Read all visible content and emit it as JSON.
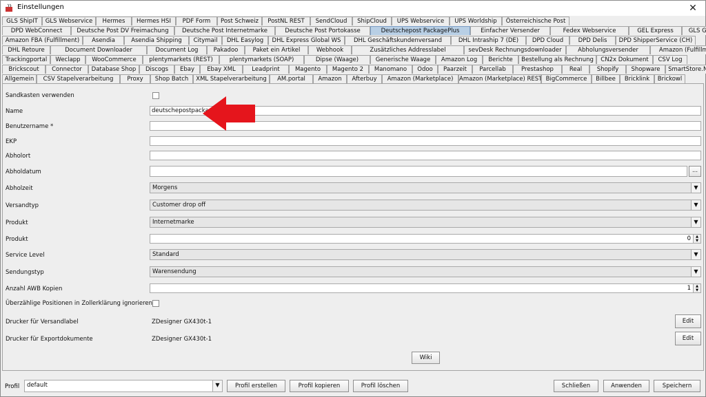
{
  "window": {
    "title": "Einstellungen",
    "close_glyph": "✕"
  },
  "tabs": {
    "row1": [
      "GLS ShipIT",
      "GLS Webservice",
      "Hermes",
      "Hermes HSI",
      "PDF Form",
      "Post Schweiz",
      "PostNL REST",
      "SendCloud",
      "ShipCloud",
      "UPS Webservice",
      "UPS Worldship",
      "Österreichische Post"
    ],
    "row2": [
      "DPD WebConnect",
      "Deutsche Post DV Freimachung",
      "Deutsche Post Internetmarke",
      "Deutsche Post Portokasse",
      "Deutschepost PackagePlus",
      "Einfacher Versender",
      "Fedex Webservice",
      "GEL Express",
      "GLS Gepard"
    ],
    "row3": [
      "Amazon FBA (Fulfillment)",
      "Asendia",
      "Asendia Shipping",
      "Citymail",
      "DHL Easylog",
      "DHL Express Global WS",
      "DHL Geschäftskundenversand",
      "DHL Intraship 7 (DE)",
      "DPD Cloud",
      "DPD Delis",
      "DPD ShipperService (CH)"
    ],
    "row4": [
      "DHL Retoure",
      "Document Downloader",
      "Document Log",
      "Pakadoo",
      "Paket ein Artikel",
      "Webhook",
      "Zusätzliches Addresslabel",
      "sevDesk Rechnungsdownloader",
      "Abholungsversender",
      "Amazon (Fulfillment)"
    ],
    "row5": [
      "Trackingportal",
      "Weclapp",
      "WooCommerce",
      "plentymarkets (REST)",
      "plentymarkets (SOAP)",
      "Dipse (Waage)",
      "Generische Waage",
      "Amazon Log",
      "Berichte",
      "Bestellung als Rechnung",
      "CN2x Dokument",
      "CSV Log"
    ],
    "row6": [
      "Brickscout",
      "Connector",
      "Database Shop",
      "Discogs",
      "Ebay",
      "Ebay XML",
      "Leadprint",
      "Magento",
      "Magento 2",
      "Manomano",
      "Odoo",
      "Paarzeit",
      "Parcellab",
      "Prestashop",
      "Real",
      "Shopify",
      "Shopware",
      "SmartStore.NET"
    ],
    "row7": [
      "Allgemein",
      "CSV Stapelverarbeitung",
      "Proxy",
      "Shop Batch",
      "XML Stapelverarbeitung",
      "AM.portal",
      "Amazon",
      "Afterbuy",
      "Amazon (Marketplace)",
      "Amazon (Marketplace) REST",
      "BigCommerce",
      "Billbee",
      "Bricklink",
      "Brickowl"
    ]
  },
  "form": {
    "sandbox_label": "Sandkasten verwenden",
    "name_label": "Name",
    "name_value": "deutschepostpackage",
    "user_label": "Benutzername *",
    "ekp_label": "EKP",
    "pickup_location_label": "Abholort",
    "pickup_date_label": "Abholdatum",
    "date_button": "...",
    "pickup_time_label": "Abholzeit",
    "pickup_time_value": "Morgens",
    "shipping_type_label": "Versandtyp",
    "shipping_type_value": "Customer drop off",
    "product_label": "Produkt",
    "product_value": "Internetmarke",
    "product2_label": "Produkt",
    "product2_value": "0",
    "service_level_label": "Service Level",
    "service_level_value": "Standard",
    "consignment_type_label": "Sendungstyp",
    "consignment_type_value": "Warensendung",
    "awb_label": "Anzahl AWB Kopien",
    "awb_value": "1",
    "ignore_label": "Überzählige Positionen in Zollerklärung ignorieren",
    "printer_label_label": "Drucker für Versandlabel",
    "printer_label_value": "ZDesigner GX430t-1",
    "printer_export_label": "Drucker für Exportdokumente",
    "printer_export_value": "ZDesigner GX430t-1",
    "edit": "Edit",
    "wiki": "Wiki"
  },
  "bottom": {
    "profile_label": "Profil",
    "profile_value": "default",
    "create": "Profil erstellen",
    "copy": "Profil kopieren",
    "delete": "Profil löschen",
    "close": "Schließen",
    "apply": "Anwenden",
    "save": "Speichern"
  },
  "colors": {
    "selected_tab": "#b8cfe5",
    "arrow": "#e5151c"
  }
}
